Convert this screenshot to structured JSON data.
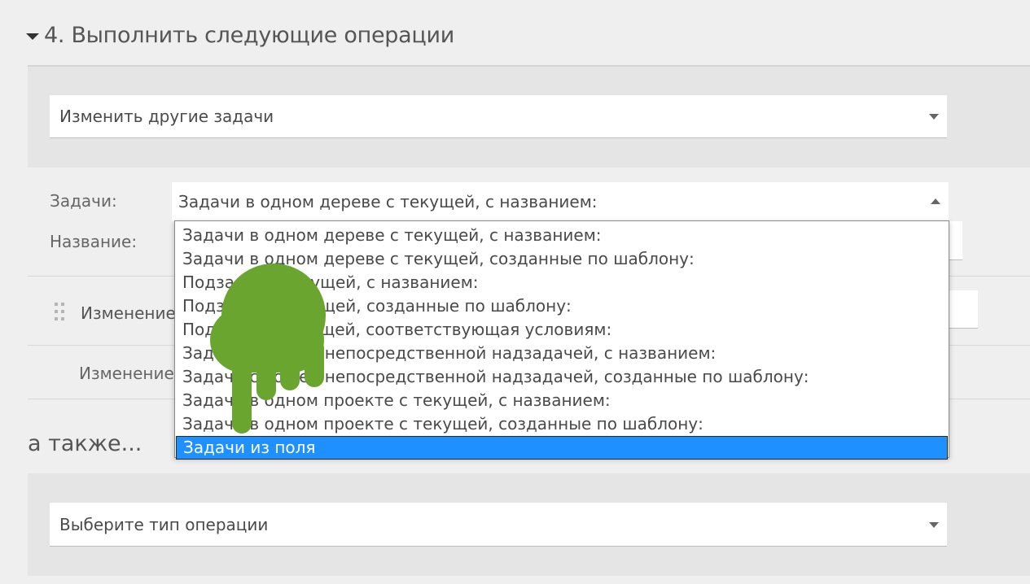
{
  "section": {
    "title": "4. Выполнить следующие операции"
  },
  "operation": {
    "selected": "Изменить другие задачи"
  },
  "tasks": {
    "label": "Задачи:",
    "selected": "Задачи в одном дереве с текущей, с названием:",
    "options": [
      "Задачи в одном дереве с текущей, с названием:",
      "Задачи в одном дереве с текущей, созданные по шаблону:",
      "Подзадачи текущей, с названием:",
      "Подзадачи текущей, созданные по шаблону:",
      "Подзадача текущей, соответствующая условиям:",
      "Задачи с общей непосредственной надзадачей, с названием:",
      "Задачи с общей непосредственной надзадачей, созданные по шаблону:",
      "Задачи в одном проекте с текущей, с названием:",
      "Задачи в одном проекте с текущей, созданные по шаблону:",
      "Задачи из поля"
    ],
    "highlighted_option": "Задачи из поля"
  },
  "name": {
    "label": "Название:"
  },
  "changes": {
    "item_1_label": "Изменение",
    "item_2_label": "Изменение"
  },
  "also": {
    "label": "а также..."
  },
  "new_operation": {
    "placeholder": "Выберите тип операции"
  },
  "colors": {
    "highlight": "#1e90ff",
    "hand_cursor": "#6aa52f"
  },
  "icons": {
    "cursor": "hand-pointer-icon",
    "drag": "drag-handle-icon",
    "expand": "caret-down-icon"
  }
}
